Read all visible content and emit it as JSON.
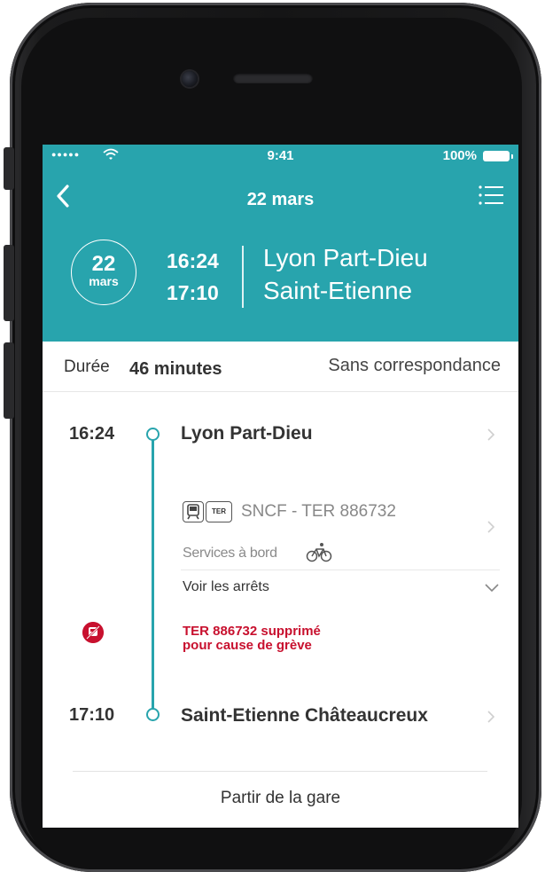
{
  "status_bar": {
    "time": "9:41",
    "battery": "100%",
    "signal_icon": "cellular-signal-dots",
    "wifi_icon": "wifi-icon",
    "battery_icon": "battery-full-icon"
  },
  "header": {
    "title": "22 mars",
    "back_icon": "chevron-left-icon",
    "list_icon": "list-menu-icon",
    "accent_color": "#28a4ad"
  },
  "trip": {
    "date_day": "22",
    "date_month": "mars",
    "departure_time": "16:24",
    "arrival_time": "17:10",
    "departure_station": "Lyon Part-Dieu",
    "arrival_station": "Saint-Etienne"
  },
  "summary": {
    "duration_label": "Durée",
    "duration_value": "46 minutes",
    "correspondance": "Sans correspondance"
  },
  "journey": {
    "stops": [
      {
        "time": "16:24",
        "name": "Lyon Part-Dieu"
      },
      {
        "time": "17:10",
        "name": "Saint-Etienne Châteaucreux"
      }
    ],
    "train": {
      "train_icon": "train-icon",
      "ter_badge": "TER",
      "operator": "SNCF - TER 886732"
    },
    "services_label": "Services à bord",
    "services_icon": "bicycle-icon",
    "stops_link": "Voir les arrêts",
    "alert": {
      "icon": "strike-cancelled-icon",
      "line1": "TER 886732 supprimé",
      "line2": "pour cause de grève",
      "color": "#c8102e"
    }
  },
  "footer": {
    "depart_link": "Partir de la gare"
  }
}
